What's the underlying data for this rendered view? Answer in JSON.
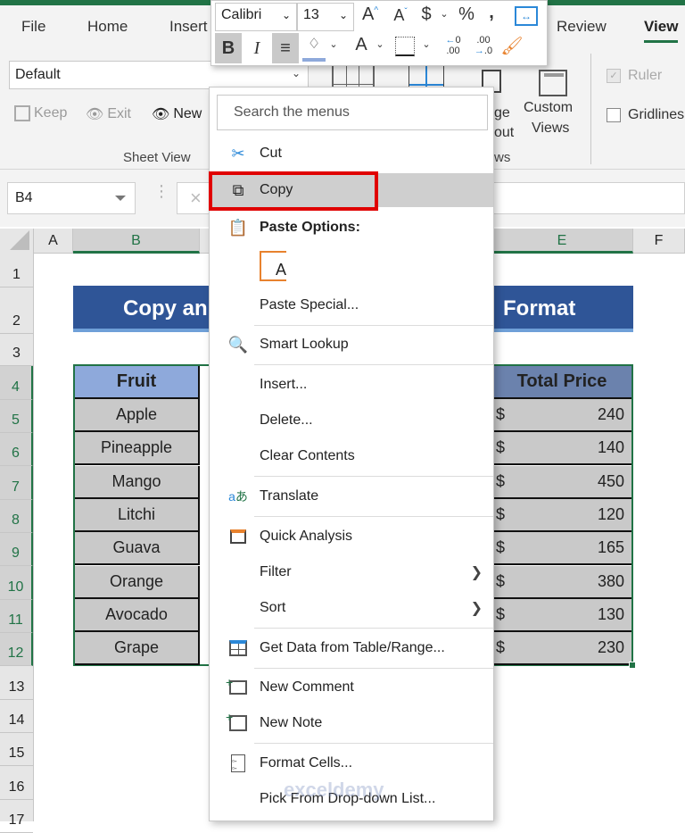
{
  "ribbon": {
    "tabs": [
      "File",
      "Home",
      "Insert",
      "Review",
      "View"
    ],
    "active_tab": "View",
    "sheet_view_select": "Default",
    "sheet_view_buttons": [
      "Keep",
      "Exit",
      "New"
    ],
    "group_sheet_view": "Sheet View",
    "page_layout_partial": [
      "ge",
      "out"
    ],
    "custom_views": [
      "Custom",
      "Views"
    ],
    "group_workbook_views_partial": "ws",
    "show": {
      "ruler_label": "Ruler",
      "ruler_checked": true,
      "ruler_disabled": true,
      "gridlines_label": "Gridlines",
      "gridlines_checked": false
    }
  },
  "formula_bar": {
    "name_box": "B4",
    "cancel_icon": "×",
    "formula": ""
  },
  "columns": [
    "A",
    "B",
    "E",
    "F"
  ],
  "selected_columns": [
    "B",
    "E"
  ],
  "rows": [
    "1",
    "2",
    "3",
    "4",
    "5",
    "6",
    "7",
    "8",
    "9",
    "10",
    "11",
    "12",
    "13",
    "14",
    "15",
    "16",
    "17"
  ],
  "selected_rows": [
    "4",
    "5",
    "6",
    "7",
    "8",
    "9",
    "10",
    "11",
    "12"
  ],
  "sheet": {
    "title_left": "Copy an",
    "title_right": "Format",
    "table": {
      "headers": {
        "fruit": "Fruit",
        "total": "Total Price"
      },
      "currency": "$",
      "rows": [
        {
          "fruit": "Apple",
          "total": "240"
        },
        {
          "fruit": "Pineapple",
          "total": "140"
        },
        {
          "fruit": "Mango",
          "total": "450"
        },
        {
          "fruit": "Litchi",
          "total": "120"
        },
        {
          "fruit": "Guava",
          "total": "165"
        },
        {
          "fruit": "Orange",
          "total": "380"
        },
        {
          "fruit": "Avocado",
          "total": "130"
        },
        {
          "fruit": "Grape",
          "total": "230"
        }
      ]
    }
  },
  "mini_toolbar": {
    "font": "Calibri",
    "size": "13",
    "icons": [
      "increase-font",
      "decrease-font",
      "currency",
      "percent",
      "comma",
      "merge",
      "bold",
      "italic",
      "center",
      "fill-color",
      "font-color",
      "borders",
      "increase-decimal",
      "decrease-decimal",
      "format-painter"
    ]
  },
  "context_menu": {
    "search_placeholder": "Search the menus",
    "items": [
      {
        "label": "Cut",
        "icon": "scissors"
      },
      {
        "label": "Copy",
        "icon": "copy",
        "highlighted": true
      },
      {
        "label": "Paste Options:",
        "icon": "paste",
        "bold": true
      },
      {
        "label": "",
        "icon": "paste-keep-text"
      },
      {
        "label": "Paste Special..."
      },
      {
        "label": "Smart Lookup",
        "icon": "smart-lookup"
      },
      {
        "label": "Insert..."
      },
      {
        "label": "Delete..."
      },
      {
        "label": "Clear Contents"
      },
      {
        "label": "Translate",
        "icon": "translate"
      },
      {
        "label": "Quick Analysis",
        "icon": "quick-analysis"
      },
      {
        "label": "Filter",
        "submenu": true
      },
      {
        "label": "Sort",
        "submenu": true
      },
      {
        "label": "Get Data from Table/Range...",
        "icon": "table"
      },
      {
        "label": "New Comment",
        "icon": "new-comment"
      },
      {
        "label": "New Note",
        "icon": "new-note"
      },
      {
        "label": "Format Cells...",
        "icon": "format-cells"
      },
      {
        "label": "Pick From Drop-down List..."
      }
    ]
  },
  "watermark": "exceldemy",
  "colors": {
    "excel_green": "#217346",
    "title_fill": "#2f5597",
    "header_fill": "#8ea9db",
    "highlight_box": "#e00000"
  }
}
